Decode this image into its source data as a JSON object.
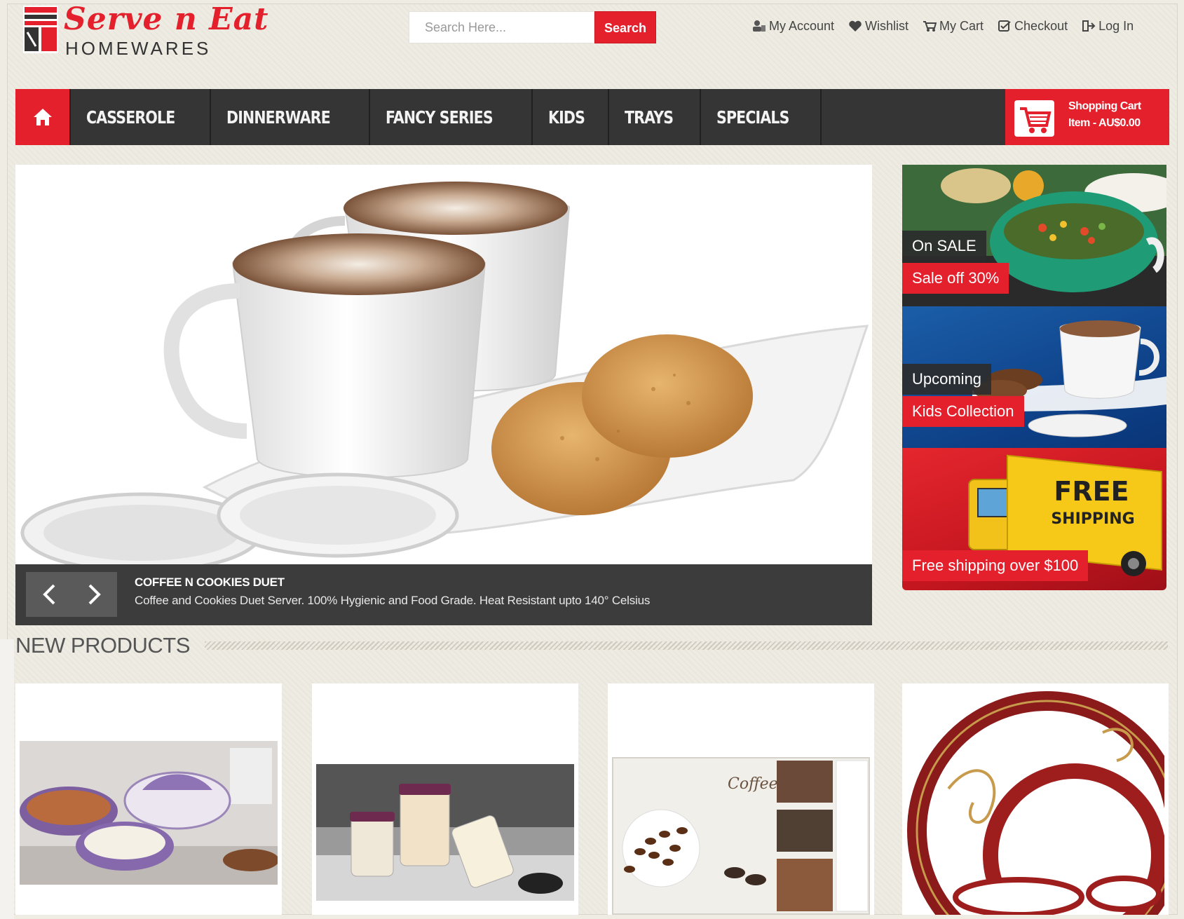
{
  "brand": {
    "name": "Serve n Eat",
    "subtitle": "HOMEWARES"
  },
  "search": {
    "placeholder": "Search Here...",
    "button_label": "Search"
  },
  "top_links": [
    {
      "label": "My Account",
      "icon": "account-icon"
    },
    {
      "label": "Wishlist",
      "icon": "heart-icon"
    },
    {
      "label": "My Cart",
      "icon": "cart-icon"
    },
    {
      "label": "Checkout",
      "icon": "checkout-icon"
    },
    {
      "label": "Log In",
      "icon": "login-icon"
    }
  ],
  "nav": {
    "home_icon": "home-icon",
    "items": [
      "CASSEROLE",
      "DINNERWARE",
      "FANCY SERIES",
      "KIDS",
      "TRAYS",
      "SPECIALS"
    ],
    "cart_line1": "Shopping Cart",
    "cart_line2": "Item - AU$0.00"
  },
  "slider": {
    "title": "COFFEE N COOKIES DUET",
    "description": "Coffee and Cookies Duet Server. 100% Hygienic and Food Grade. Heat Resistant upto 140° Celsius"
  },
  "banners": [
    {
      "tag": "On SALE",
      "label": "Sale off 30%"
    },
    {
      "tag": "Upcoming",
      "label": "Kids Collection"
    },
    {
      "label": "Free shipping over $100",
      "artwork_text_1": "FREE",
      "artwork_text_2": "SHIPPING"
    }
  ],
  "new_products": {
    "title": "NEW PRODUCTS",
    "artwork_text": "Coffee Break"
  },
  "colors": {
    "accent": "#e3202c",
    "nav_bg": "#353535",
    "page_bg": "#eeebe2"
  }
}
